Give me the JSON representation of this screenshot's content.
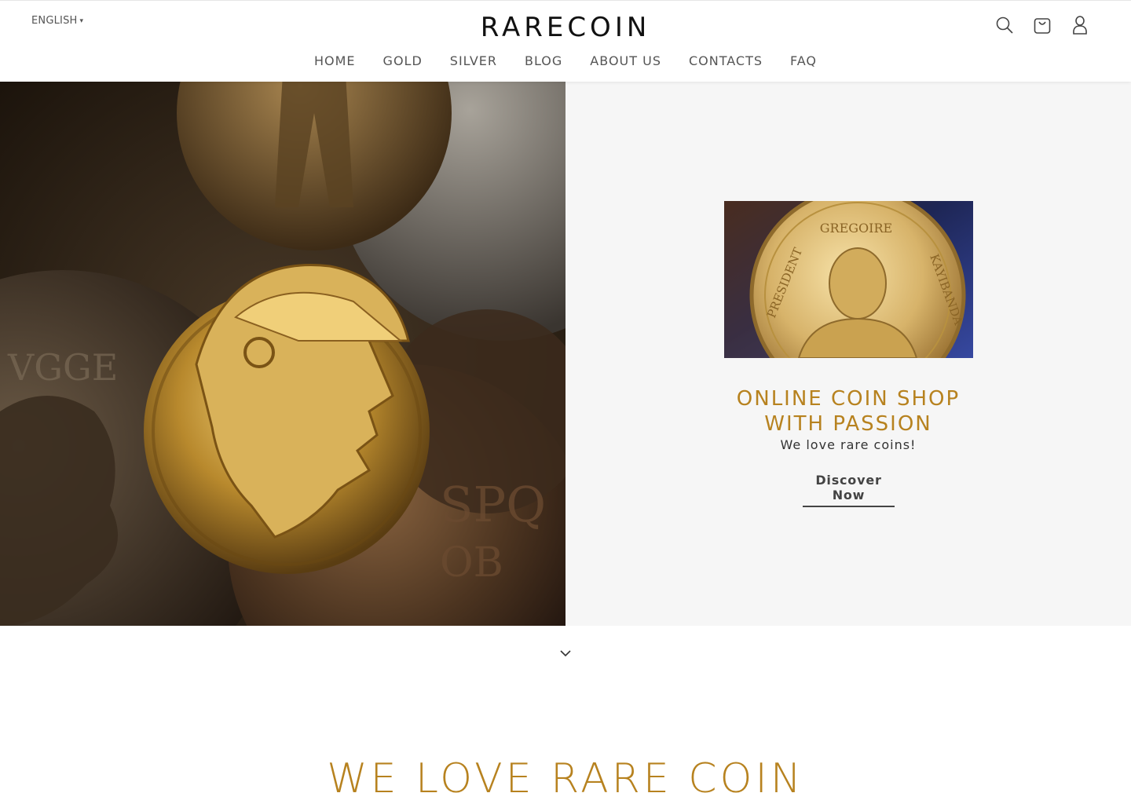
{
  "header": {
    "language": "ENGLISH",
    "logo": "RARECOIN",
    "nav": [
      "HOME",
      "GOLD",
      "SILVER",
      "BLOG",
      "ABOUT US",
      "CONTACTS",
      "FAQ"
    ],
    "icons": [
      "search-icon",
      "cart-icon",
      "account-icon"
    ]
  },
  "hero": {
    "promo_title_line1": "ONLINE COIN SHOP",
    "promo_title_line2": "WITH PASSION",
    "promo_subtitle": "We love rare coins!",
    "promo_link": "Discover Now",
    "coin_inscription_left": "PRESIDENT",
    "coin_inscription_top": "GREGOIRE",
    "coin_inscription_right": "KAYIBANDA"
  },
  "section": {
    "title": "WE LOVE RARE COIN"
  },
  "colors": {
    "accent_gold": "#b7821f",
    "hero_right_bg": "#f6f6f6"
  }
}
